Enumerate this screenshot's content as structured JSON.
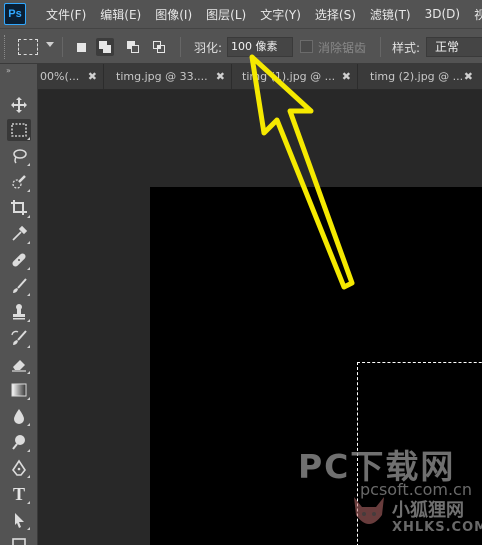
{
  "app": {
    "logo": "Ps"
  },
  "menu": {
    "items": [
      "文件(F)",
      "编辑(E)",
      "图像(I)",
      "图层(L)",
      "文字(Y)",
      "选择(S)",
      "滤镜(T)",
      "3D(D)",
      "视图"
    ]
  },
  "options": {
    "feather_label": "羽化:",
    "feather_value": "100 像素",
    "antialias_label": "消除锯齿",
    "style_label": "样式:",
    "style_value": "正常"
  },
  "tabs": [
    {
      "label": "00%(...",
      "close": "✖"
    },
    {
      "label": "timg.jpg @ 33....",
      "close": "✖"
    },
    {
      "label": "timg (1).jpg @ ...",
      "close": "✖"
    },
    {
      "label": "timg (2).jpg @ ...",
      "close": "✖"
    }
  ],
  "tools": [
    "move-tool-icon",
    "rectangular-marquee-icon",
    "lasso-icon",
    "quick-selection-icon",
    "crop-icon",
    "eyedropper-icon",
    "healing-brush-icon",
    "brush-icon",
    "clone-stamp-icon",
    "history-brush-icon",
    "eraser-icon",
    "gradient-icon",
    "blur-icon",
    "dodge-icon",
    "pen-icon",
    "type-icon",
    "path-selection-icon"
  ],
  "tool_labels": {
    "type": "T"
  },
  "collapse_glyph": "»",
  "watermark": {
    "main": "PC下载网",
    "sub": "pcsoft.com.cn",
    "cn": "小狐狸网",
    "en": "XHLKS.COM"
  },
  "colors": {
    "annotation_arrow": "#f5e900",
    "ps_blue": "#31a8ff",
    "panel": "#535353",
    "canvas_bg": "#282828"
  }
}
